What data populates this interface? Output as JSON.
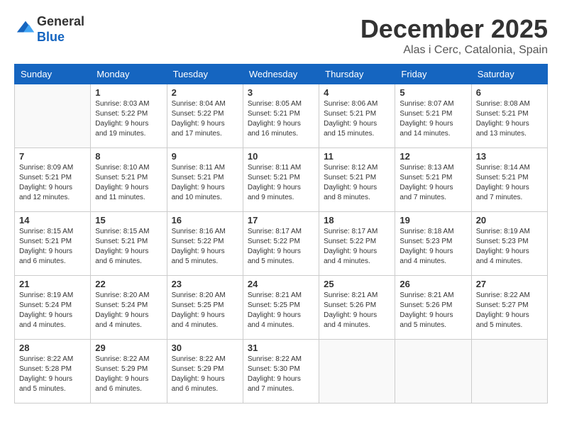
{
  "logo": {
    "general": "General",
    "blue": "Blue"
  },
  "header": {
    "month": "December 2025",
    "location": "Alas i Cerc, Catalonia, Spain"
  },
  "weekdays": [
    "Sunday",
    "Monday",
    "Tuesday",
    "Wednesday",
    "Thursday",
    "Friday",
    "Saturday"
  ],
  "weeks": [
    [
      {
        "day": "",
        "sunrise": "",
        "sunset": "",
        "daylight": ""
      },
      {
        "day": "1",
        "sunrise": "Sunrise: 8:03 AM",
        "sunset": "Sunset: 5:22 PM",
        "daylight": "Daylight: 9 hours and 19 minutes."
      },
      {
        "day": "2",
        "sunrise": "Sunrise: 8:04 AM",
        "sunset": "Sunset: 5:22 PM",
        "daylight": "Daylight: 9 hours and 17 minutes."
      },
      {
        "day": "3",
        "sunrise": "Sunrise: 8:05 AM",
        "sunset": "Sunset: 5:21 PM",
        "daylight": "Daylight: 9 hours and 16 minutes."
      },
      {
        "day": "4",
        "sunrise": "Sunrise: 8:06 AM",
        "sunset": "Sunset: 5:21 PM",
        "daylight": "Daylight: 9 hours and 15 minutes."
      },
      {
        "day": "5",
        "sunrise": "Sunrise: 8:07 AM",
        "sunset": "Sunset: 5:21 PM",
        "daylight": "Daylight: 9 hours and 14 minutes."
      },
      {
        "day": "6",
        "sunrise": "Sunrise: 8:08 AM",
        "sunset": "Sunset: 5:21 PM",
        "daylight": "Daylight: 9 hours and 13 minutes."
      }
    ],
    [
      {
        "day": "7",
        "sunrise": "Sunrise: 8:09 AM",
        "sunset": "Sunset: 5:21 PM",
        "daylight": "Daylight: 9 hours and 12 minutes."
      },
      {
        "day": "8",
        "sunrise": "Sunrise: 8:10 AM",
        "sunset": "Sunset: 5:21 PM",
        "daylight": "Daylight: 9 hours and 11 minutes."
      },
      {
        "day": "9",
        "sunrise": "Sunrise: 8:11 AM",
        "sunset": "Sunset: 5:21 PM",
        "daylight": "Daylight: 9 hours and 10 minutes."
      },
      {
        "day": "10",
        "sunrise": "Sunrise: 8:11 AM",
        "sunset": "Sunset: 5:21 PM",
        "daylight": "Daylight: 9 hours and 9 minutes."
      },
      {
        "day": "11",
        "sunrise": "Sunrise: 8:12 AM",
        "sunset": "Sunset: 5:21 PM",
        "daylight": "Daylight: 9 hours and 8 minutes."
      },
      {
        "day": "12",
        "sunrise": "Sunrise: 8:13 AM",
        "sunset": "Sunset: 5:21 PM",
        "daylight": "Daylight: 9 hours and 7 minutes."
      },
      {
        "day": "13",
        "sunrise": "Sunrise: 8:14 AM",
        "sunset": "Sunset: 5:21 PM",
        "daylight": "Daylight: 9 hours and 7 minutes."
      }
    ],
    [
      {
        "day": "14",
        "sunrise": "Sunrise: 8:15 AM",
        "sunset": "Sunset: 5:21 PM",
        "daylight": "Daylight: 9 hours and 6 minutes."
      },
      {
        "day": "15",
        "sunrise": "Sunrise: 8:15 AM",
        "sunset": "Sunset: 5:21 PM",
        "daylight": "Daylight: 9 hours and 6 minutes."
      },
      {
        "day": "16",
        "sunrise": "Sunrise: 8:16 AM",
        "sunset": "Sunset: 5:22 PM",
        "daylight": "Daylight: 9 hours and 5 minutes."
      },
      {
        "day": "17",
        "sunrise": "Sunrise: 8:17 AM",
        "sunset": "Sunset: 5:22 PM",
        "daylight": "Daylight: 9 hours and 5 minutes."
      },
      {
        "day": "18",
        "sunrise": "Sunrise: 8:17 AM",
        "sunset": "Sunset: 5:22 PM",
        "daylight": "Daylight: 9 hours and 4 minutes."
      },
      {
        "day": "19",
        "sunrise": "Sunrise: 8:18 AM",
        "sunset": "Sunset: 5:23 PM",
        "daylight": "Daylight: 9 hours and 4 minutes."
      },
      {
        "day": "20",
        "sunrise": "Sunrise: 8:19 AM",
        "sunset": "Sunset: 5:23 PM",
        "daylight": "Daylight: 9 hours and 4 minutes."
      }
    ],
    [
      {
        "day": "21",
        "sunrise": "Sunrise: 8:19 AM",
        "sunset": "Sunset: 5:24 PM",
        "daylight": "Daylight: 9 hours and 4 minutes."
      },
      {
        "day": "22",
        "sunrise": "Sunrise: 8:20 AM",
        "sunset": "Sunset: 5:24 PM",
        "daylight": "Daylight: 9 hours and 4 minutes."
      },
      {
        "day": "23",
        "sunrise": "Sunrise: 8:20 AM",
        "sunset": "Sunset: 5:25 PM",
        "daylight": "Daylight: 9 hours and 4 minutes."
      },
      {
        "day": "24",
        "sunrise": "Sunrise: 8:21 AM",
        "sunset": "Sunset: 5:25 PM",
        "daylight": "Daylight: 9 hours and 4 minutes."
      },
      {
        "day": "25",
        "sunrise": "Sunrise: 8:21 AM",
        "sunset": "Sunset: 5:26 PM",
        "daylight": "Daylight: 9 hours and 4 minutes."
      },
      {
        "day": "26",
        "sunrise": "Sunrise: 8:21 AM",
        "sunset": "Sunset: 5:26 PM",
        "daylight": "Daylight: 9 hours and 5 minutes."
      },
      {
        "day": "27",
        "sunrise": "Sunrise: 8:22 AM",
        "sunset": "Sunset: 5:27 PM",
        "daylight": "Daylight: 9 hours and 5 minutes."
      }
    ],
    [
      {
        "day": "28",
        "sunrise": "Sunrise: 8:22 AM",
        "sunset": "Sunset: 5:28 PM",
        "daylight": "Daylight: 9 hours and 5 minutes."
      },
      {
        "day": "29",
        "sunrise": "Sunrise: 8:22 AM",
        "sunset": "Sunset: 5:29 PM",
        "daylight": "Daylight: 9 hours and 6 minutes."
      },
      {
        "day": "30",
        "sunrise": "Sunrise: 8:22 AM",
        "sunset": "Sunset: 5:29 PM",
        "daylight": "Daylight: 9 hours and 6 minutes."
      },
      {
        "day": "31",
        "sunrise": "Sunrise: 8:22 AM",
        "sunset": "Sunset: 5:30 PM",
        "daylight": "Daylight: 9 hours and 7 minutes."
      },
      {
        "day": "",
        "sunrise": "",
        "sunset": "",
        "daylight": ""
      },
      {
        "day": "",
        "sunrise": "",
        "sunset": "",
        "daylight": ""
      },
      {
        "day": "",
        "sunrise": "",
        "sunset": "",
        "daylight": ""
      }
    ]
  ]
}
